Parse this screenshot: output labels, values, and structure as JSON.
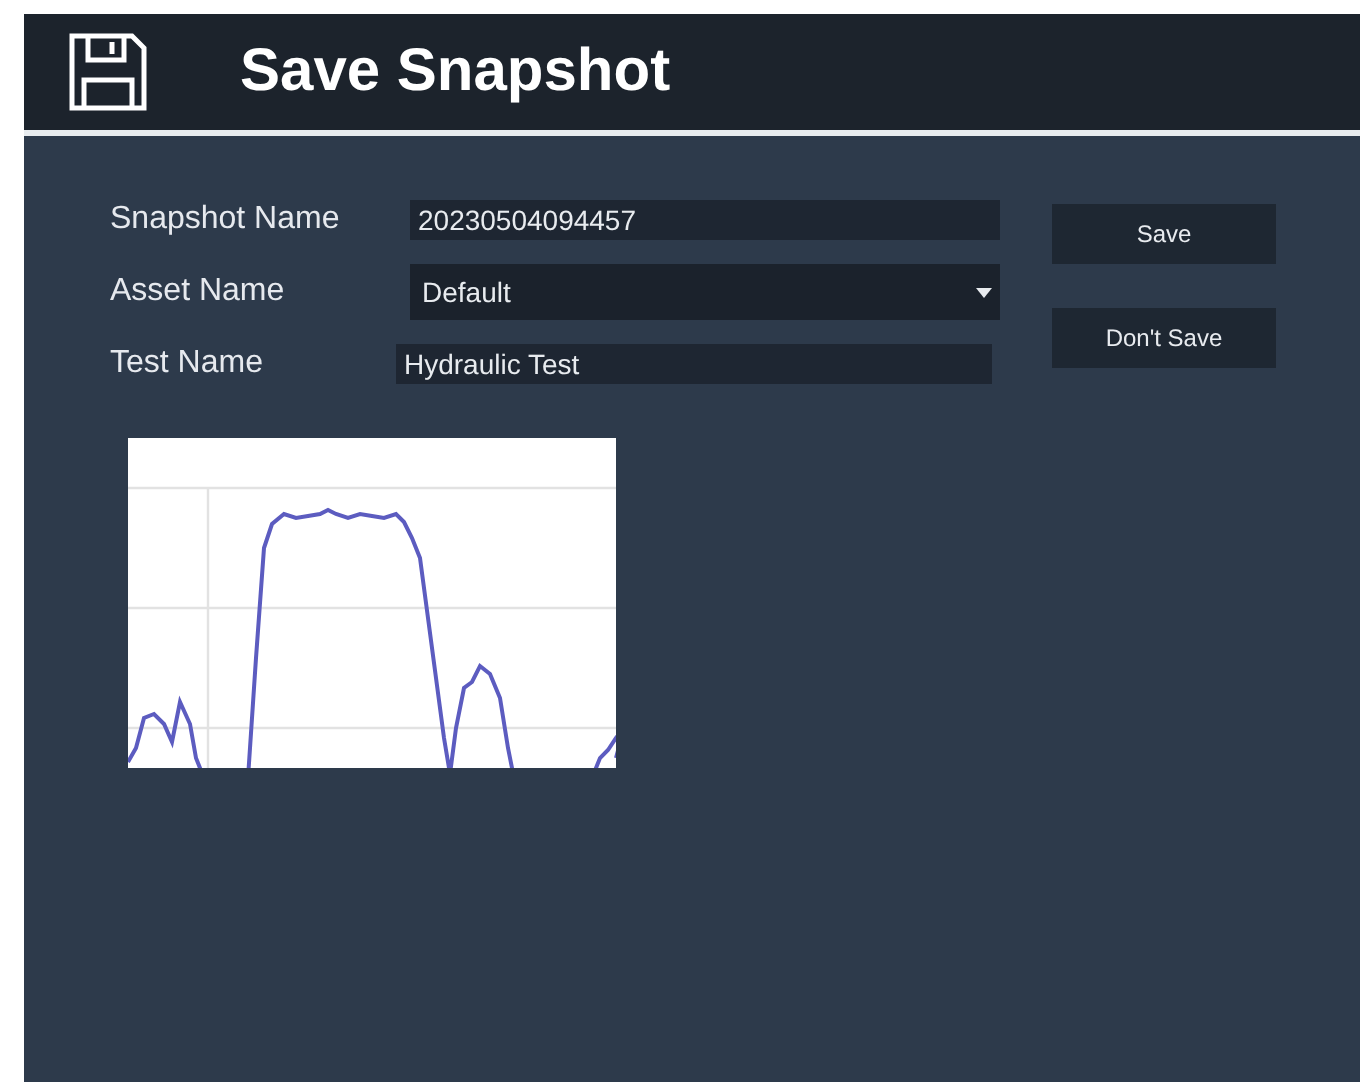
{
  "window": {
    "title": "Save Snapshot"
  },
  "fields": [
    {
      "label": "Snapshot Name",
      "kind": "text",
      "value": "20230504094457"
    },
    {
      "label": "Asset Name",
      "kind": "dropdown",
      "value": "Default"
    },
    {
      "label": "Test Name",
      "kind": "text",
      "value": "Hydraulic Test"
    }
  ],
  "buttons": [
    "Save",
    "Don't Save"
  ],
  "preview": {
    "kind": "picture"
  }
}
